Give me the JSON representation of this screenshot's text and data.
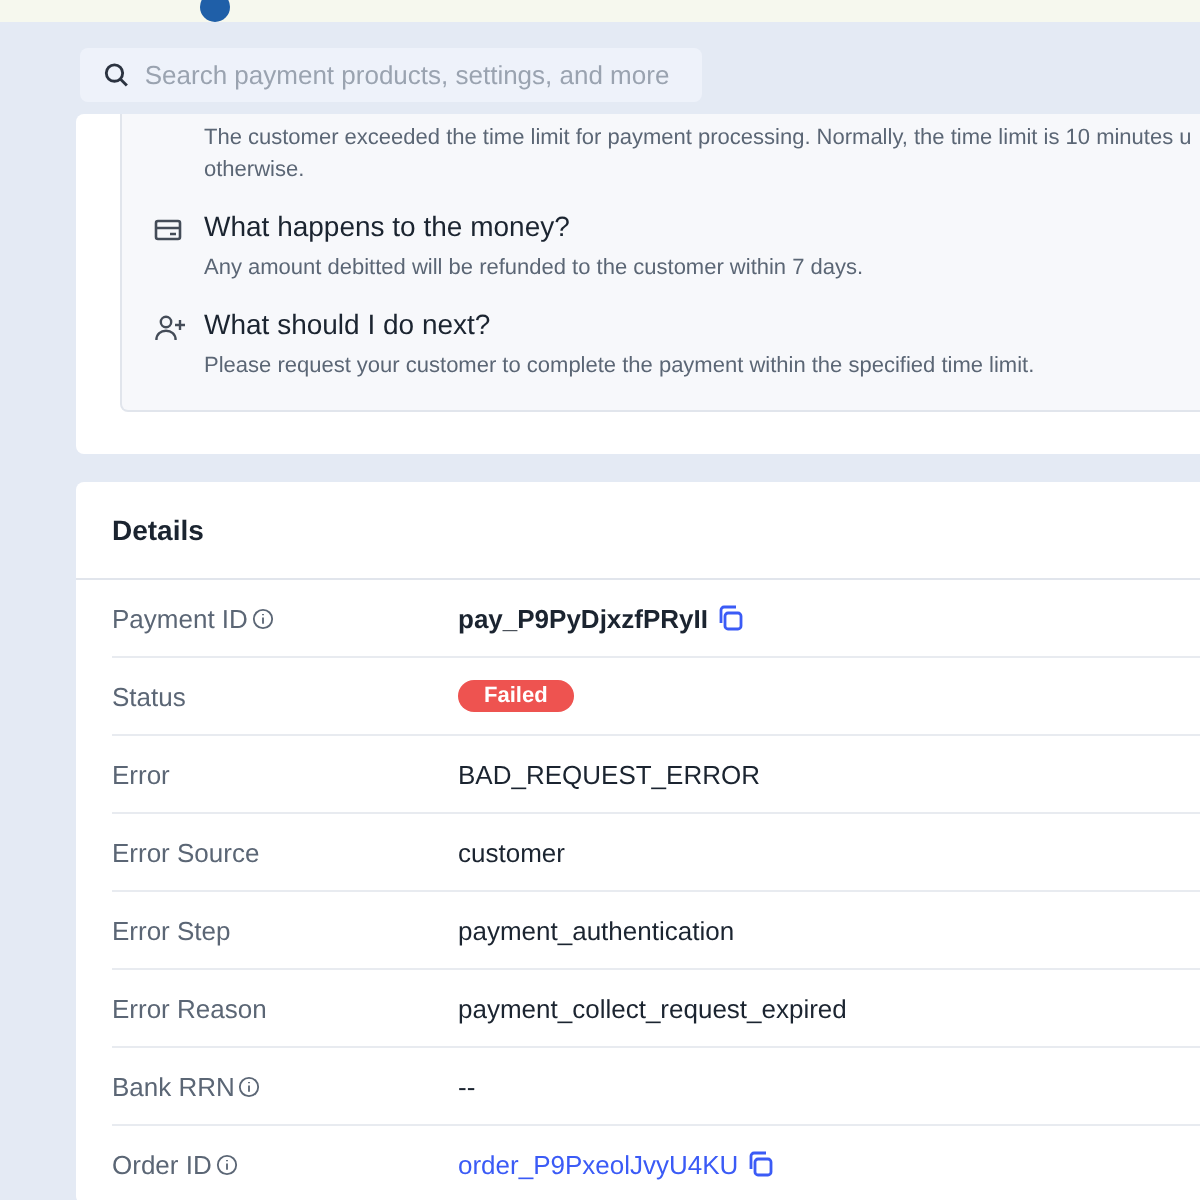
{
  "search": {
    "placeholder": "Search payment products, settings, and more"
  },
  "info_items": [
    {
      "lines": [
        "The customer exceeded the time limit for payment processing. Normally, the time limit is 10 minutes u",
        "otherwise."
      ]
    },
    {
      "title": "What happens to the money?",
      "lines": [
        "Any amount debitted will be refunded to the customer within 7 days."
      ]
    },
    {
      "title": "What should I do next?",
      "lines": [
        "Please request your customer to complete the payment within the specified time limit."
      ]
    }
  ],
  "details": {
    "title": "Details",
    "rows": [
      {
        "label": "Payment ID",
        "info": true,
        "value": "pay_P9PyDjxzfPRyII",
        "kind": "id"
      },
      {
        "label": "Status",
        "info": false,
        "value": "Failed",
        "kind": "badge"
      },
      {
        "label": "Error",
        "info": false,
        "value": "BAD_REQUEST_ERROR",
        "kind": "text"
      },
      {
        "label": "Error Source",
        "info": false,
        "value": "customer",
        "kind": "text"
      },
      {
        "label": "Error Step",
        "info": false,
        "value": "payment_authentication",
        "kind": "text"
      },
      {
        "label": "Error Reason",
        "info": false,
        "value": "payment_collect_request_expired",
        "kind": "text"
      },
      {
        "label": "Bank RRN",
        "info": true,
        "value": "--",
        "kind": "text"
      },
      {
        "label": "Order ID",
        "info": true,
        "value": "order_P9PxeolJvyU4KU",
        "kind": "link"
      }
    ]
  }
}
